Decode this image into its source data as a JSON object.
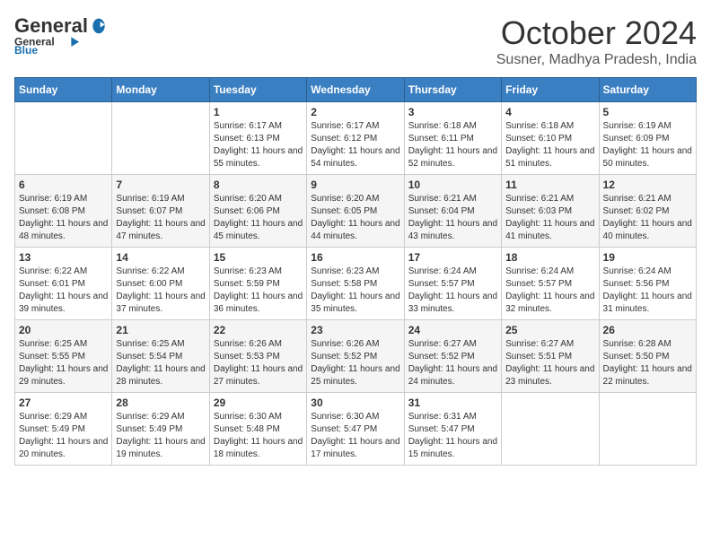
{
  "logo": {
    "general": "General",
    "blue": "Blue"
  },
  "title": "October 2024",
  "location": "Susner, Madhya Pradesh, India",
  "days_of_week": [
    "Sunday",
    "Monday",
    "Tuesday",
    "Wednesday",
    "Thursday",
    "Friday",
    "Saturday"
  ],
  "weeks": [
    [
      {
        "day": "",
        "sunrise": "",
        "sunset": "",
        "daylight": ""
      },
      {
        "day": "",
        "sunrise": "",
        "sunset": "",
        "daylight": ""
      },
      {
        "day": "1",
        "sunrise": "Sunrise: 6:17 AM",
        "sunset": "Sunset: 6:13 PM",
        "daylight": "Daylight: 11 hours and 55 minutes."
      },
      {
        "day": "2",
        "sunrise": "Sunrise: 6:17 AM",
        "sunset": "Sunset: 6:12 PM",
        "daylight": "Daylight: 11 hours and 54 minutes."
      },
      {
        "day": "3",
        "sunrise": "Sunrise: 6:18 AM",
        "sunset": "Sunset: 6:11 PM",
        "daylight": "Daylight: 11 hours and 52 minutes."
      },
      {
        "day": "4",
        "sunrise": "Sunrise: 6:18 AM",
        "sunset": "Sunset: 6:10 PM",
        "daylight": "Daylight: 11 hours and 51 minutes."
      },
      {
        "day": "5",
        "sunrise": "Sunrise: 6:19 AM",
        "sunset": "Sunset: 6:09 PM",
        "daylight": "Daylight: 11 hours and 50 minutes."
      }
    ],
    [
      {
        "day": "6",
        "sunrise": "Sunrise: 6:19 AM",
        "sunset": "Sunset: 6:08 PM",
        "daylight": "Daylight: 11 hours and 48 minutes."
      },
      {
        "day": "7",
        "sunrise": "Sunrise: 6:19 AM",
        "sunset": "Sunset: 6:07 PM",
        "daylight": "Daylight: 11 hours and 47 minutes."
      },
      {
        "day": "8",
        "sunrise": "Sunrise: 6:20 AM",
        "sunset": "Sunset: 6:06 PM",
        "daylight": "Daylight: 11 hours and 45 minutes."
      },
      {
        "day": "9",
        "sunrise": "Sunrise: 6:20 AM",
        "sunset": "Sunset: 6:05 PM",
        "daylight": "Daylight: 11 hours and 44 minutes."
      },
      {
        "day": "10",
        "sunrise": "Sunrise: 6:21 AM",
        "sunset": "Sunset: 6:04 PM",
        "daylight": "Daylight: 11 hours and 43 minutes."
      },
      {
        "day": "11",
        "sunrise": "Sunrise: 6:21 AM",
        "sunset": "Sunset: 6:03 PM",
        "daylight": "Daylight: 11 hours and 41 minutes."
      },
      {
        "day": "12",
        "sunrise": "Sunrise: 6:21 AM",
        "sunset": "Sunset: 6:02 PM",
        "daylight": "Daylight: 11 hours and 40 minutes."
      }
    ],
    [
      {
        "day": "13",
        "sunrise": "Sunrise: 6:22 AM",
        "sunset": "Sunset: 6:01 PM",
        "daylight": "Daylight: 11 hours and 39 minutes."
      },
      {
        "day": "14",
        "sunrise": "Sunrise: 6:22 AM",
        "sunset": "Sunset: 6:00 PM",
        "daylight": "Daylight: 11 hours and 37 minutes."
      },
      {
        "day": "15",
        "sunrise": "Sunrise: 6:23 AM",
        "sunset": "Sunset: 5:59 PM",
        "daylight": "Daylight: 11 hours and 36 minutes."
      },
      {
        "day": "16",
        "sunrise": "Sunrise: 6:23 AM",
        "sunset": "Sunset: 5:58 PM",
        "daylight": "Daylight: 11 hours and 35 minutes."
      },
      {
        "day": "17",
        "sunrise": "Sunrise: 6:24 AM",
        "sunset": "Sunset: 5:57 PM",
        "daylight": "Daylight: 11 hours and 33 minutes."
      },
      {
        "day": "18",
        "sunrise": "Sunrise: 6:24 AM",
        "sunset": "Sunset: 5:57 PM",
        "daylight": "Daylight: 11 hours and 32 minutes."
      },
      {
        "day": "19",
        "sunrise": "Sunrise: 6:24 AM",
        "sunset": "Sunset: 5:56 PM",
        "daylight": "Daylight: 11 hours and 31 minutes."
      }
    ],
    [
      {
        "day": "20",
        "sunrise": "Sunrise: 6:25 AM",
        "sunset": "Sunset: 5:55 PM",
        "daylight": "Daylight: 11 hours and 29 minutes."
      },
      {
        "day": "21",
        "sunrise": "Sunrise: 6:25 AM",
        "sunset": "Sunset: 5:54 PM",
        "daylight": "Daylight: 11 hours and 28 minutes."
      },
      {
        "day": "22",
        "sunrise": "Sunrise: 6:26 AM",
        "sunset": "Sunset: 5:53 PM",
        "daylight": "Daylight: 11 hours and 27 minutes."
      },
      {
        "day": "23",
        "sunrise": "Sunrise: 6:26 AM",
        "sunset": "Sunset: 5:52 PM",
        "daylight": "Daylight: 11 hours and 25 minutes."
      },
      {
        "day": "24",
        "sunrise": "Sunrise: 6:27 AM",
        "sunset": "Sunset: 5:52 PM",
        "daylight": "Daylight: 11 hours and 24 minutes."
      },
      {
        "day": "25",
        "sunrise": "Sunrise: 6:27 AM",
        "sunset": "Sunset: 5:51 PM",
        "daylight": "Daylight: 11 hours and 23 minutes."
      },
      {
        "day": "26",
        "sunrise": "Sunrise: 6:28 AM",
        "sunset": "Sunset: 5:50 PM",
        "daylight": "Daylight: 11 hours and 22 minutes."
      }
    ],
    [
      {
        "day": "27",
        "sunrise": "Sunrise: 6:29 AM",
        "sunset": "Sunset: 5:49 PM",
        "daylight": "Daylight: 11 hours and 20 minutes."
      },
      {
        "day": "28",
        "sunrise": "Sunrise: 6:29 AM",
        "sunset": "Sunset: 5:49 PM",
        "daylight": "Daylight: 11 hours and 19 minutes."
      },
      {
        "day": "29",
        "sunrise": "Sunrise: 6:30 AM",
        "sunset": "Sunset: 5:48 PM",
        "daylight": "Daylight: 11 hours and 18 minutes."
      },
      {
        "day": "30",
        "sunrise": "Sunrise: 6:30 AM",
        "sunset": "Sunset: 5:47 PM",
        "daylight": "Daylight: 11 hours and 17 minutes."
      },
      {
        "day": "31",
        "sunrise": "Sunrise: 6:31 AM",
        "sunset": "Sunset: 5:47 PM",
        "daylight": "Daylight: 11 hours and 15 minutes."
      },
      {
        "day": "",
        "sunrise": "",
        "sunset": "",
        "daylight": ""
      },
      {
        "day": "",
        "sunrise": "",
        "sunset": "",
        "daylight": ""
      }
    ]
  ]
}
